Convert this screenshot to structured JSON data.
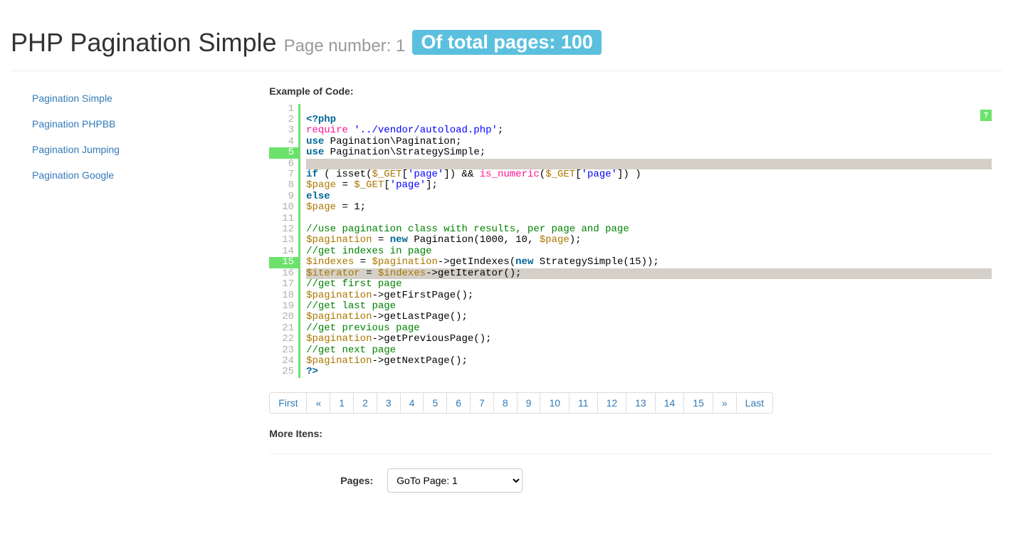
{
  "header": {
    "title": "PHP Pagination Simple",
    "subtitle": "Page number: 1",
    "badge": "Of total pages: 100"
  },
  "nav": {
    "items": [
      {
        "label": "Pagination Simple"
      },
      {
        "label": "Pagination PHPBB"
      },
      {
        "label": "Pagination Jumping"
      },
      {
        "label": "Pagination Google"
      }
    ]
  },
  "example": {
    "title": "Example of Code:",
    "highlighted_lines": [
      5,
      15
    ],
    "help_icon": "?",
    "lines": [
      {
        "n": 1,
        "tokens": []
      },
      {
        "n": 2,
        "tokens": [
          {
            "c": "kw",
            "t": "<?php"
          }
        ]
      },
      {
        "n": 3,
        "tokens": [
          {
            "c": "func",
            "t": "require"
          },
          {
            "c": "pl",
            "t": " "
          },
          {
            "c": "str",
            "t": "'../vendor/autoload.php'"
          },
          {
            "c": "pl",
            "t": ";"
          }
        ]
      },
      {
        "n": 4,
        "tokens": [
          {
            "c": "kw",
            "t": "use"
          },
          {
            "c": "pl",
            "t": " Pagination\\Pagination;"
          }
        ]
      },
      {
        "n": 5,
        "tokens": [
          {
            "c": "kw",
            "t": "use"
          },
          {
            "c": "pl",
            "t": " Pagination\\StrategySimple;"
          }
        ]
      },
      {
        "n": 6,
        "tokens": []
      },
      {
        "n": 7,
        "tokens": [
          {
            "c": "kw",
            "t": "if"
          },
          {
            "c": "pl",
            "t": " ( isset("
          },
          {
            "c": "var",
            "t": "$_GET"
          },
          {
            "c": "pl",
            "t": "["
          },
          {
            "c": "str",
            "t": "'page'"
          },
          {
            "c": "pl",
            "t": "]) && "
          },
          {
            "c": "func",
            "t": "is_numeric"
          },
          {
            "c": "pl",
            "t": "("
          },
          {
            "c": "var",
            "t": "$_GET"
          },
          {
            "c": "pl",
            "t": "["
          },
          {
            "c": "str",
            "t": "'page'"
          },
          {
            "c": "pl",
            "t": "]) )"
          }
        ]
      },
      {
        "n": 8,
        "tokens": [
          {
            "c": "var",
            "t": "$page"
          },
          {
            "c": "pl",
            "t": " = "
          },
          {
            "c": "var",
            "t": "$_GET"
          },
          {
            "c": "pl",
            "t": "["
          },
          {
            "c": "str",
            "t": "'page'"
          },
          {
            "c": "pl",
            "t": "];"
          }
        ]
      },
      {
        "n": 9,
        "tokens": [
          {
            "c": "kw",
            "t": "else"
          }
        ]
      },
      {
        "n": 10,
        "tokens": [
          {
            "c": "var",
            "t": "$page"
          },
          {
            "c": "pl",
            "t": " = 1;"
          }
        ]
      },
      {
        "n": 11,
        "tokens": []
      },
      {
        "n": 12,
        "tokens": [
          {
            "c": "com",
            "t": "//use pagination class with results, per page and page"
          }
        ]
      },
      {
        "n": 13,
        "tokens": [
          {
            "c": "var",
            "t": "$pagination"
          },
          {
            "c": "pl",
            "t": " = "
          },
          {
            "c": "kw",
            "t": "new"
          },
          {
            "c": "pl",
            "t": " Pagination(1000, 10, "
          },
          {
            "c": "var",
            "t": "$page"
          },
          {
            "c": "pl",
            "t": ");"
          }
        ]
      },
      {
        "n": 14,
        "tokens": [
          {
            "c": "com",
            "t": "//get indexes in page"
          }
        ]
      },
      {
        "n": 15,
        "tokens": [
          {
            "c": "var",
            "t": "$indexes"
          },
          {
            "c": "pl",
            "t": " = "
          },
          {
            "c": "var",
            "t": "$pagination"
          },
          {
            "c": "pl",
            "t": "->getIndexes("
          },
          {
            "c": "kw",
            "t": "new"
          },
          {
            "c": "pl",
            "t": " StrategySimple(15));"
          }
        ]
      },
      {
        "n": 16,
        "tokens": [
          {
            "c": "var",
            "t": "$iterator"
          },
          {
            "c": "pl",
            "t": " = "
          },
          {
            "c": "var",
            "t": "$indexes"
          },
          {
            "c": "pl",
            "t": "->getIterator();"
          }
        ]
      },
      {
        "n": 17,
        "tokens": [
          {
            "c": "com",
            "t": "//get first page"
          }
        ]
      },
      {
        "n": 18,
        "tokens": [
          {
            "c": "var",
            "t": "$pagination"
          },
          {
            "c": "pl",
            "t": "->getFirstPage();"
          }
        ]
      },
      {
        "n": 19,
        "tokens": [
          {
            "c": "com",
            "t": "//get last page"
          }
        ]
      },
      {
        "n": 20,
        "tokens": [
          {
            "c": "var",
            "t": "$pagination"
          },
          {
            "c": "pl",
            "t": "->getLastPage();"
          }
        ]
      },
      {
        "n": 21,
        "tokens": [
          {
            "c": "com",
            "t": "//get previous page"
          }
        ]
      },
      {
        "n": 22,
        "tokens": [
          {
            "c": "var",
            "t": "$pagination"
          },
          {
            "c": "pl",
            "t": "->getPreviousPage();"
          }
        ]
      },
      {
        "n": 23,
        "tokens": [
          {
            "c": "com",
            "t": "//get next page"
          }
        ]
      },
      {
        "n": 24,
        "tokens": [
          {
            "c": "var",
            "t": "$pagination"
          },
          {
            "c": "pl",
            "t": "->getNextPage();"
          }
        ]
      },
      {
        "n": 25,
        "tokens": [
          {
            "c": "kw",
            "t": "?>"
          }
        ]
      }
    ]
  },
  "pagination": {
    "items": [
      "First",
      "«",
      "1",
      "2",
      "3",
      "4",
      "5",
      "6",
      "7",
      "8",
      "9",
      "10",
      "11",
      "12",
      "13",
      "14",
      "15",
      "»",
      "Last"
    ]
  },
  "more": {
    "title": "More Itens:",
    "pages_label": "Pages:",
    "select_value": "GoTo Page: 1"
  }
}
